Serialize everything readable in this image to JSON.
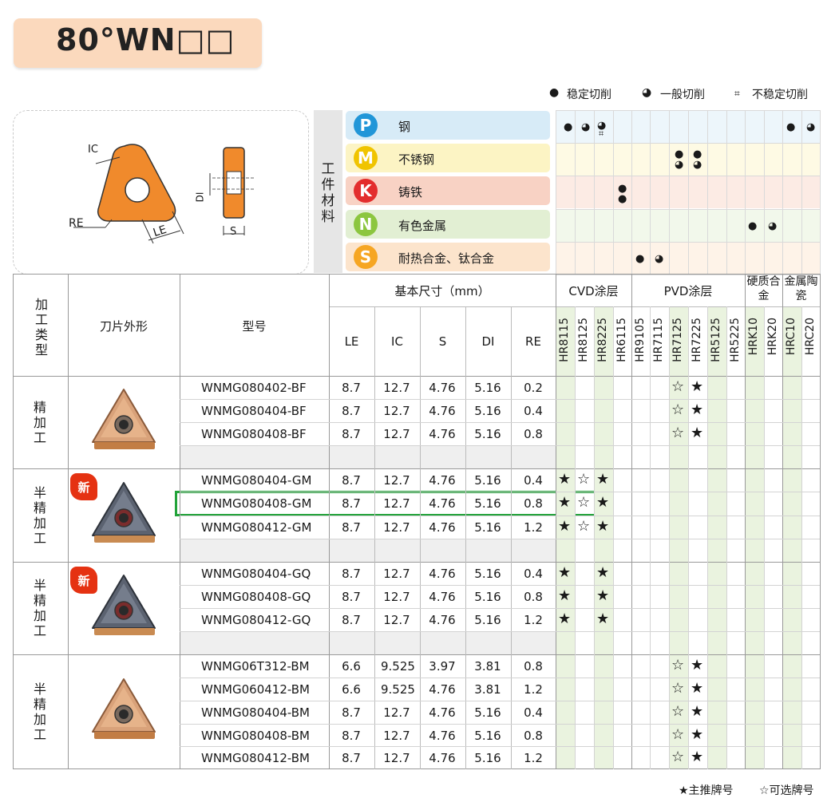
{
  "title": "80°WN□□",
  "legend_top": {
    "stable": "稳定切削",
    "general": "一般切削",
    "unstable": "不稳定切削"
  },
  "legend_bottom": {
    "main": "★主推牌号",
    "optional": "☆可选牌号"
  },
  "diagram": {
    "ic": "IC",
    "re": "RE",
    "le": "LE",
    "di": "DI",
    "s": "S"
  },
  "workpiece_label": "工件材料",
  "materials": [
    {
      "letter": "P",
      "name": "钢",
      "color": "#2196d8",
      "bg": "#d7ebf7"
    },
    {
      "letter": "M",
      "name": "不锈钢",
      "color": "#f0c400",
      "bg": "#fcf4c4"
    },
    {
      "letter": "K",
      "name": "铸铁",
      "color": "#e32d2d",
      "bg": "#f8d2c4"
    },
    {
      "letter": "N",
      "name": "有色金属",
      "color": "#8cc63f",
      "bg": "#e2efd3"
    },
    {
      "letter": "S",
      "name": "耐热合金、钛合金",
      "color": "#f6a623",
      "bg": "#fce4cc"
    }
  ],
  "table_headers": {
    "type": "加工类型",
    "shape": "刀片外形",
    "model": "型号",
    "basic_dims": "基本尺寸（mm）",
    "cvd": "CVD涂层",
    "pvd": "PVD涂层",
    "hard_alloy": "硬质合金",
    "cermet": "金属陶瓷",
    "dims": [
      "LE",
      "IC",
      "S",
      "DI",
      "RE"
    ],
    "grades": [
      "HR8115",
      "HR8125",
      "HR8225",
      "HR6115",
      "HR9105",
      "HR7115",
      "HR7125",
      "HR7225",
      "HR5125",
      "HR5225",
      "HRK10",
      "HRK20",
      "HRC10",
      "HRC20"
    ]
  },
  "new_badge": "新",
  "groups": [
    {
      "type": "精加工",
      "rows": [
        {
          "model": "WNMG080402-BF",
          "le": "8.7",
          "ic": "12.7",
          "s": "4.76",
          "di": "5.16",
          "re": "0.2",
          "marks": [
            "",
            "",
            "",
            "",
            "",
            "",
            "☆",
            "★",
            "",
            "",
            "",
            "",
            "",
            ""
          ]
        },
        {
          "model": "WNMG080404-BF",
          "le": "8.7",
          "ic": "12.7",
          "s": "4.76",
          "di": "5.16",
          "re": "0.4",
          "marks": [
            "",
            "",
            "",
            "",
            "",
            "",
            "☆",
            "★",
            "",
            "",
            "",
            "",
            "",
            ""
          ]
        },
        {
          "model": "WNMG080408-BF",
          "le": "8.7",
          "ic": "12.7",
          "s": "4.76",
          "di": "5.16",
          "re": "0.8",
          "marks": [
            "",
            "",
            "",
            "",
            "",
            "",
            "☆",
            "★",
            "",
            "",
            "",
            "",
            "",
            ""
          ]
        }
      ]
    },
    {
      "type": "半精加工",
      "is_new": true,
      "rows": [
        {
          "model": "WNMG080404-GM",
          "le": "8.7",
          "ic": "12.7",
          "s": "4.76",
          "di": "5.16",
          "re": "0.4",
          "marks": [
            "★",
            "☆",
            "★",
            "",
            "",
            "",
            "",
            "",
            "",
            "",
            "",
            "",
            "",
            ""
          ]
        },
        {
          "model": "WNMG080408-GM",
          "le": "8.7",
          "ic": "12.7",
          "s": "4.76",
          "di": "5.16",
          "re": "0.8",
          "marks": [
            "★",
            "☆",
            "★",
            "",
            "",
            "",
            "",
            "",
            "",
            "",
            "",
            "",
            "",
            ""
          ]
        },
        {
          "model": "WNMG080412-GM",
          "le": "8.7",
          "ic": "12.7",
          "s": "4.76",
          "di": "5.16",
          "re": "1.2",
          "marks": [
            "★",
            "☆",
            "★",
            "",
            "",
            "",
            "",
            "",
            "",
            "",
            "",
            "",
            "",
            ""
          ]
        }
      ]
    },
    {
      "type": "半精加工",
      "is_new": true,
      "rows": [
        {
          "model": "WNMG080404-GQ",
          "le": "8.7",
          "ic": "12.7",
          "s": "4.76",
          "di": "5.16",
          "re": "0.4",
          "marks": [
            "★",
            "",
            "★",
            "",
            "",
            "",
            "",
            "",
            "",
            "",
            "",
            "",
            "",
            ""
          ]
        },
        {
          "model": "WNMG080408-GQ",
          "le": "8.7",
          "ic": "12.7",
          "s": "4.76",
          "di": "5.16",
          "re": "0.8",
          "marks": [
            "★",
            "",
            "★",
            "",
            "",
            "",
            "",
            "",
            "",
            "",
            "",
            "",
            "",
            ""
          ]
        },
        {
          "model": "WNMG080412-GQ",
          "le": "8.7",
          "ic": "12.7",
          "s": "4.76",
          "di": "5.16",
          "re": "1.2",
          "marks": [
            "★",
            "",
            "★",
            "",
            "",
            "",
            "",
            "",
            "",
            "",
            "",
            "",
            "",
            ""
          ]
        }
      ]
    },
    {
      "type": "半精加工",
      "rows": [
        {
          "model": "WNMG06T312-BM",
          "le": "6.6",
          "ic": "9.525",
          "s": "3.97",
          "di": "3.81",
          "re": "0.8",
          "marks": [
            "",
            "",
            "",
            "",
            "",
            "",
            "☆",
            "★",
            "",
            "",
            "",
            "",
            "",
            ""
          ]
        },
        {
          "model": "WNMG060412-BM",
          "le": "6.6",
          "ic": "9.525",
          "s": "4.76",
          "di": "3.81",
          "re": "1.2",
          "marks": [
            "",
            "",
            "",
            "",
            "",
            "",
            "☆",
            "★",
            "",
            "",
            "",
            "",
            "",
            ""
          ]
        },
        {
          "model": "WNMG080404-BM",
          "le": "8.7",
          "ic": "12.7",
          "s": "4.76",
          "di": "5.16",
          "re": "0.4",
          "marks": [
            "",
            "",
            "",
            "",
            "",
            "",
            "☆",
            "★",
            "",
            "",
            "",
            "",
            "",
            ""
          ]
        },
        {
          "model": "WNMG080408-BM",
          "le": "8.7",
          "ic": "12.7",
          "s": "4.76",
          "di": "5.16",
          "re": "0.8",
          "marks": [
            "",
            "",
            "",
            "",
            "",
            "",
            "☆",
            "★",
            "",
            "",
            "",
            "",
            "",
            ""
          ]
        },
        {
          "model": "WNMG080412-BM",
          "le": "8.7",
          "ic": "12.7",
          "s": "4.76",
          "di": "5.16",
          "re": "1.2",
          "marks": [
            "",
            "",
            "",
            "",
            "",
            "",
            "☆",
            "★",
            "",
            "",
            "",
            "",
            "",
            ""
          ]
        }
      ]
    }
  ],
  "highlighted_model": "WNMG080408-GM",
  "colors": {
    "highlight": "#22a33a",
    "title_bg": "#fbd9bd",
    "insert_orange": "#f08a2c",
    "green_col": "#eaf3df"
  }
}
